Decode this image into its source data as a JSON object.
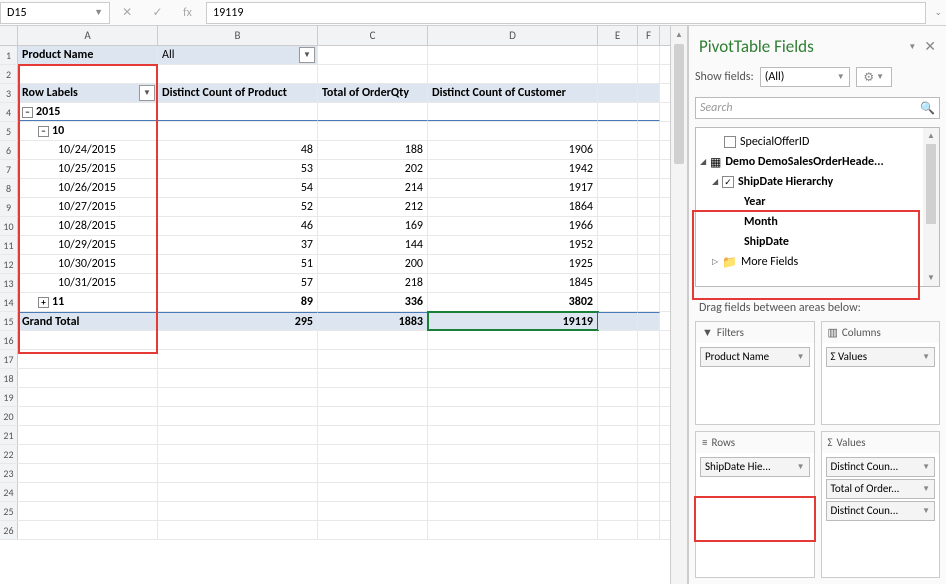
{
  "formula_bar": {
    "cell_ref": "D15",
    "fx": "fx",
    "value": "19119"
  },
  "columns": [
    "A",
    "B",
    "C",
    "D",
    "E",
    "F"
  ],
  "pivot": {
    "filter_label": "Product Name",
    "filter_value": "All",
    "row_labels": "Row Labels",
    "col_b": "Distinct Count of Product",
    "col_c": "Total of OrderQty",
    "col_d": "Distinct Count of Customer",
    "year": "2015",
    "month": "10",
    "month_collapsed": "11",
    "month_collapsed_vals": {
      "b": "89",
      "c": "336",
      "d": "3802"
    },
    "grand_total": "Grand Total",
    "gt_vals": {
      "b": "295",
      "c": "1883",
      "d": "19119"
    },
    "days": [
      {
        "date": "10/24/2015",
        "b": "48",
        "c": "188",
        "d": "1906"
      },
      {
        "date": "10/25/2015",
        "b": "53",
        "c": "202",
        "d": "1942"
      },
      {
        "date": "10/26/2015",
        "b": "54",
        "c": "214",
        "d": "1917"
      },
      {
        "date": "10/27/2015",
        "b": "52",
        "c": "212",
        "d": "1864"
      },
      {
        "date": "10/28/2015",
        "b": "46",
        "c": "169",
        "d": "1966"
      },
      {
        "date": "10/29/2015",
        "b": "37",
        "c": "144",
        "d": "1952"
      },
      {
        "date": "10/30/2015",
        "b": "51",
        "c": "200",
        "d": "1925"
      },
      {
        "date": "10/31/2015",
        "b": "57",
        "c": "218",
        "d": "1845"
      }
    ]
  },
  "panel": {
    "title": "PivotTable Fields",
    "show_fields_label": "Show fields:",
    "show_fields_value": "(All)",
    "search_placeholder": "Search",
    "field_special": "SpecialOfferID",
    "field_table": "Demo DemoSalesOrderHeade...",
    "field_hierarchy": "ShipDate Hierarchy",
    "field_year": "Year",
    "field_month": "Month",
    "field_shipdate": "ShipDate",
    "field_more": "More Fields",
    "drag_hint": "Drag fields between areas below:",
    "filters_label": "Filters",
    "columns_label": "Columns",
    "rows_label": "Rows",
    "values_label": "Values",
    "filters_item": "Product Name",
    "columns_item": "Σ Values",
    "rows_item": "ShipDate Hie...",
    "values_items": [
      "Distinct Coun...",
      "Total of Order...",
      "Distinct Coun..."
    ]
  }
}
